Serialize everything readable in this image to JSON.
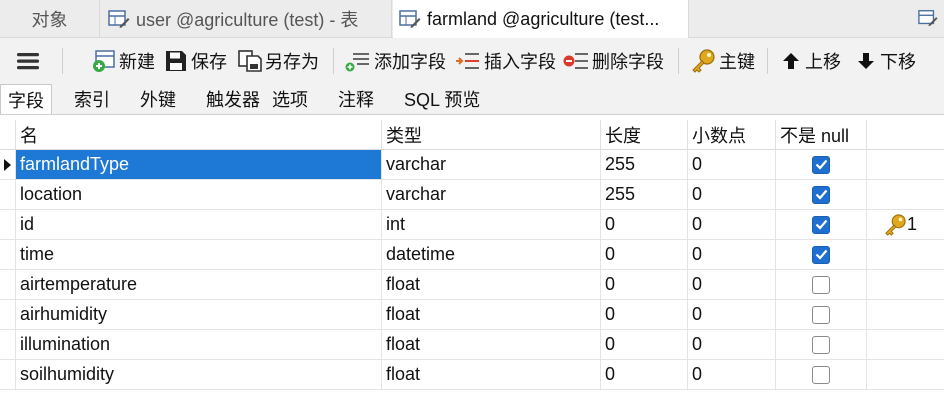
{
  "tabs": {
    "objects": "对象",
    "user": "user @agriculture (test) - 表",
    "farmland": "farmland @agriculture (test..."
  },
  "toolbar": {
    "new": "新建",
    "save": "保存",
    "save_as": "另存为",
    "add_field": "添加字段",
    "insert_field": "插入字段",
    "delete_field": "删除字段",
    "primary_key": "主键",
    "move_up": "上移",
    "move_down": "下移"
  },
  "subtabs": {
    "fields": "字段",
    "indexes": "索引",
    "foreign_keys": "外键",
    "triggers": "触发器",
    "options": "选项",
    "comment": "注释",
    "sql_preview": "SQL 预览"
  },
  "columns": {
    "name": "名",
    "type": "类型",
    "length": "长度",
    "decimals": "小数点",
    "not_null": "不是 null"
  },
  "rows": [
    {
      "name": "farmlandType",
      "type": "varchar",
      "length": "255",
      "decimals": "0",
      "not_null": true,
      "key": ""
    },
    {
      "name": "location",
      "type": "varchar",
      "length": "255",
      "decimals": "0",
      "not_null": true,
      "key": ""
    },
    {
      "name": "id",
      "type": "int",
      "length": "0",
      "decimals": "0",
      "not_null": true,
      "key": "1"
    },
    {
      "name": "time",
      "type": "datetime",
      "length": "0",
      "decimals": "0",
      "not_null": true,
      "key": ""
    },
    {
      "name": "airtemperature",
      "type": "float",
      "length": "0",
      "decimals": "0",
      "not_null": false,
      "key": ""
    },
    {
      "name": "airhumidity",
      "type": "float",
      "length": "0",
      "decimals": "0",
      "not_null": false,
      "key": ""
    },
    {
      "name": "illumination",
      "type": "float",
      "length": "0",
      "decimals": "0",
      "not_null": false,
      "key": ""
    },
    {
      "name": "soilhumidity",
      "type": "float",
      "length": "0",
      "decimals": "0",
      "not_null": false,
      "key": ""
    }
  ],
  "colors": {
    "selection": "#1e78d6",
    "checkbox_on": "#1e6fd0",
    "key_icon": "#e0a81c"
  }
}
